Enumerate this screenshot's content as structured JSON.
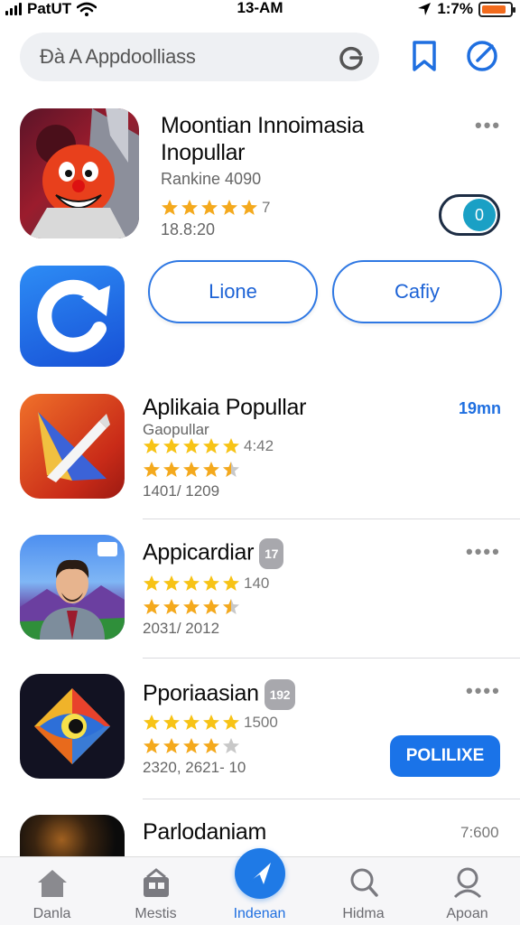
{
  "status_bar": {
    "carrier": "PatUT",
    "time": "13-AM",
    "battery_text": "1:7%",
    "battery_level": 0.85
  },
  "search": {
    "placeholder": "Đà A Appdoolliass"
  },
  "featured": {
    "title_line1": "Moontian Innoimasia",
    "title_line2": "Inopullar",
    "ranking": "Rankine 4090",
    "rating_num": "7",
    "stats": "18.8:20",
    "more": "•••"
  },
  "buttons_row": {
    "left_label": "Lione",
    "right_label": "Cafiy"
  },
  "apps": [
    {
      "title": "Aplikaia Popullar",
      "sub": "Gaopullar",
      "rating_num": "4:42",
      "stats": "1401/ 1209",
      "right_text": "19mn"
    },
    {
      "title": "Appicardiar",
      "badge": "17",
      "rating_num": "140",
      "stats": "2031/ 2012",
      "more": "••••"
    },
    {
      "title": "Pporiaasian",
      "badge": "192",
      "rating_num": "1500",
      "stats": "2320, 2621- 10",
      "more": "••••",
      "button": "POLILIXE"
    },
    {
      "title": "Parlodaniam",
      "right_text": "7:600"
    }
  ],
  "tabs": [
    {
      "label": "Danla",
      "icon": "home-icon"
    },
    {
      "label": "Mestis",
      "icon": "store-icon"
    },
    {
      "label": "Indenan",
      "icon": "paper-plane-icon",
      "active": true
    },
    {
      "label": "Hidma",
      "icon": "search-icon"
    },
    {
      "label": "Apoan",
      "icon": "profile-search-icon"
    }
  ],
  "colors": {
    "accent": "#1f7ae6",
    "star": "#f4a91d",
    "star_gray": "#c8c8c8"
  }
}
